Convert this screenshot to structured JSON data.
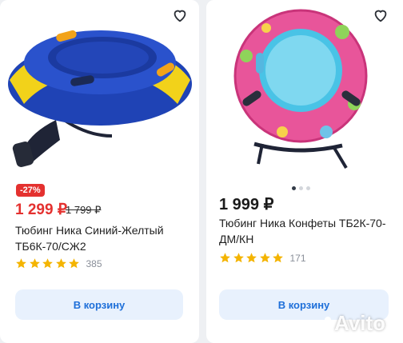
{
  "products": [
    {
      "discount": "-27%",
      "price": "1 299 ₽",
      "old_price": "1 799 ₽",
      "title": "Тюбинг Ника Синий-Желтый ТБ6К-70/СЖ2",
      "rating": 5,
      "reviews": "385",
      "cart_label": "В корзину"
    },
    {
      "price": "1 999 ₽",
      "title": "Тюбинг Ника Конфеты ТБ2К-70-ДМ/КН",
      "rating": 5,
      "reviews": "171",
      "cart_label": "В корзину"
    }
  ],
  "watermark": "Avito",
  "colors": {
    "price_sale": "#e4312f",
    "button_bg": "#e8f1fd",
    "button_text": "#1e6fd9",
    "star": "#f4b400"
  }
}
